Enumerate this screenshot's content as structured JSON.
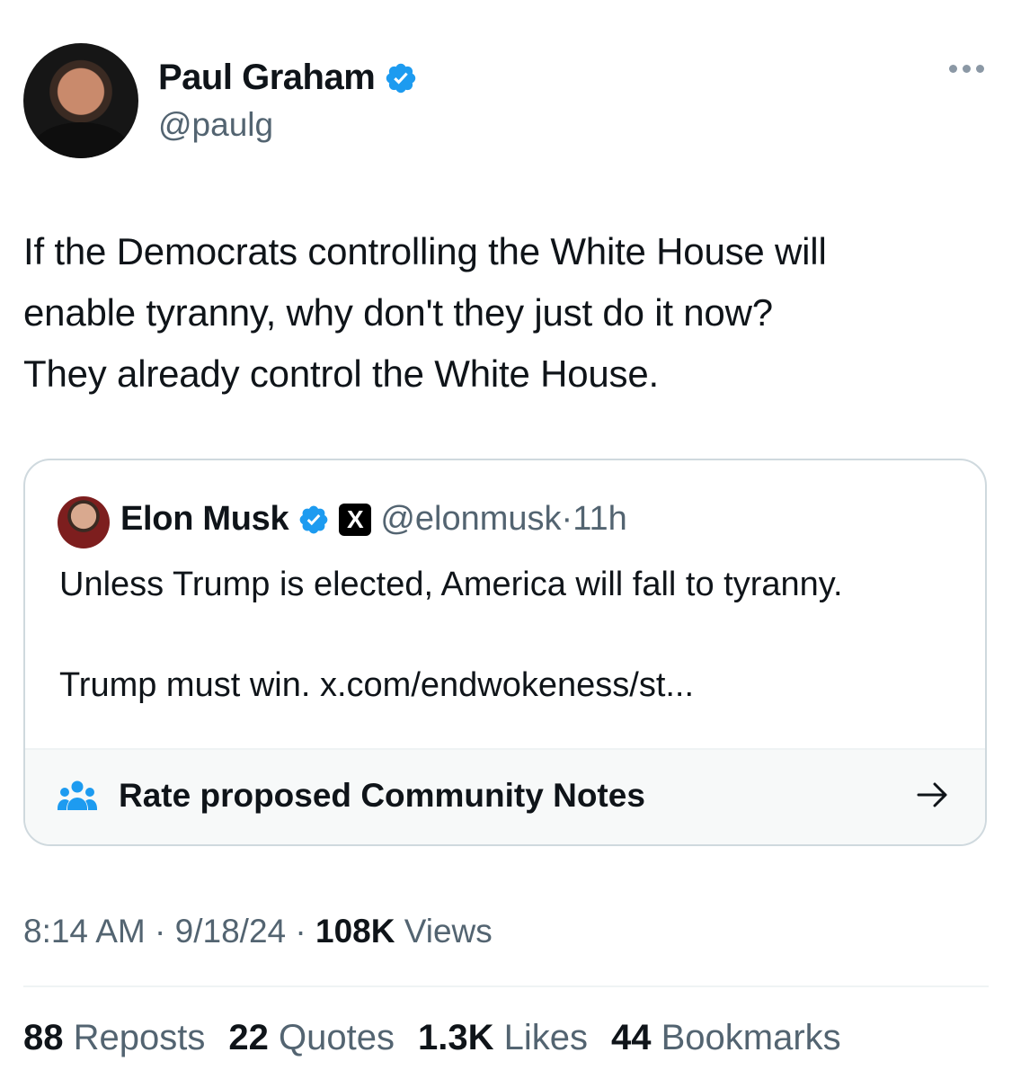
{
  "author": {
    "name": "Paul Graham",
    "handle": "@paulg"
  },
  "tweet": {
    "lines": [
      "If the Democrats controlling the White House will",
      "enable tyranny, why don't they just do it now?",
      "They already control the White House."
    ]
  },
  "quoted": {
    "name": "Elon Musk",
    "x_badge": "X",
    "handle": "@elonmusk",
    "separator": "·",
    "time": "11h",
    "paragraph1": "Unless Trump is elected, America will fall to tyranny.",
    "paragraph2": "Trump must win. x.com/endwokeness/st...",
    "notes_label": "Rate proposed Community Notes"
  },
  "meta": {
    "time": "8:14 AM",
    "sep1": "·",
    "date": "9/18/24",
    "sep2": "·",
    "views_count": "108K",
    "views_label": "Views"
  },
  "stats": [
    {
      "count": "88",
      "label": "Reposts"
    },
    {
      "count": "22",
      "label": "Quotes"
    },
    {
      "count": "1.3K",
      "label": "Likes"
    },
    {
      "count": "44",
      "label": "Bookmarks"
    }
  ],
  "colors": {
    "verified": "#1d9bf0",
    "secondary_text": "#536471",
    "border": "#cfd9de"
  },
  "icons": [
    "verified-badge-icon",
    "more-options-icon",
    "x-logo-icon",
    "community-notes-icon",
    "arrow-right-icon"
  ]
}
